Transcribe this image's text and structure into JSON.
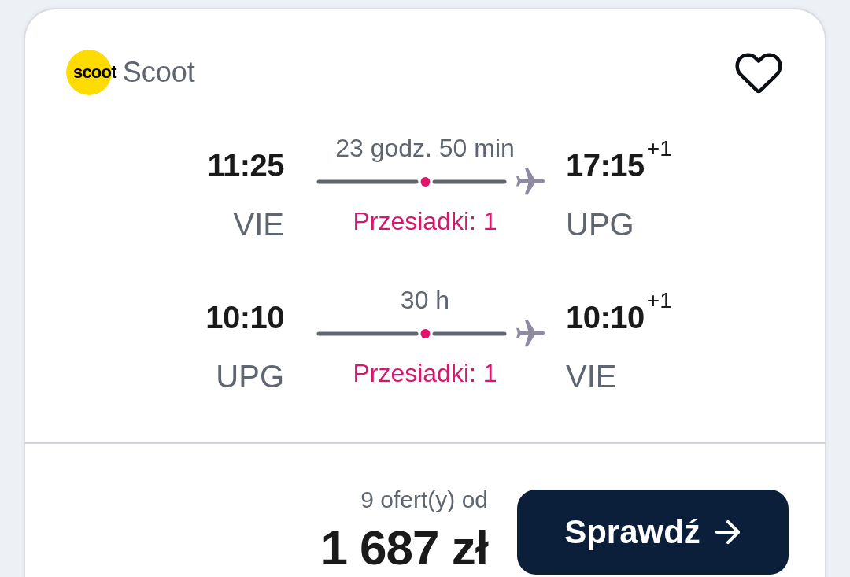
{
  "result": {
    "airline": {
      "logo_text": "scoot",
      "name": "Scoot"
    },
    "favorite": {
      "saved": false
    },
    "legs": [
      {
        "departure": {
          "time": "11:25",
          "airport": "VIE"
        },
        "duration": "23 godz. 50 min",
        "stops": "Przesiadki: 1",
        "arrival": {
          "time": "17:15",
          "day_offset": "+1",
          "airport": "UPG"
        }
      },
      {
        "departure": {
          "time": "10:10",
          "airport": "UPG"
        },
        "duration": "30 h",
        "stops": "Przesiadki: 1",
        "arrival": {
          "time": "10:10",
          "day_offset": "+1",
          "airport": "VIE"
        }
      }
    ],
    "offers_label": "9 ofert(y) od",
    "price": "1 687 zł",
    "check_button": {
      "label": "Sprawdź"
    }
  }
}
